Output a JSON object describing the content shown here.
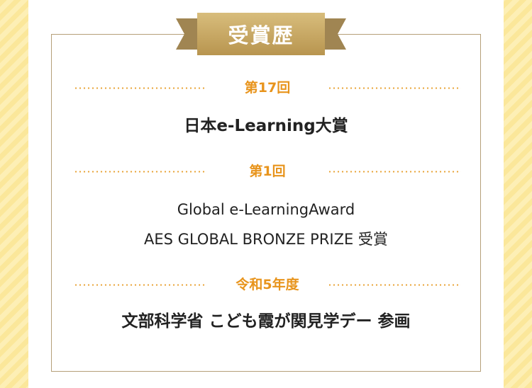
{
  "title": "受賞歴",
  "colors": {
    "ribbon_gold": "#c9a85c",
    "ribbon_dark": "#a08552",
    "heading_orange": "#e8941c",
    "frame_border": "#b59f78",
    "background_stripe": "#fbe79a"
  },
  "sections": [
    {
      "label": "第17回",
      "lines": [
        "日本e-Learning大賞"
      ]
    },
    {
      "label": "第1回",
      "lines": [
        "Global e-LearningAward",
        "AES GLOBAL BRONZE PRIZE 受賞"
      ]
    },
    {
      "label": "令和5年度",
      "lines": [
        "文部科学省 こども霞が関見学デー 参画"
      ]
    }
  ]
}
